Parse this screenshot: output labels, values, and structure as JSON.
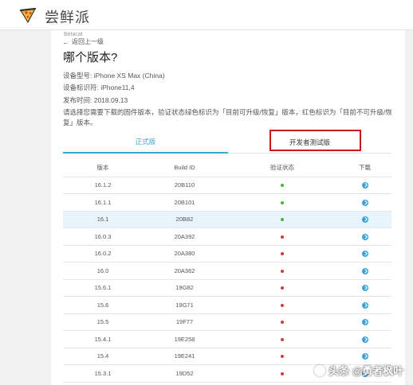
{
  "header": {
    "brand": "尝鲜派",
    "colors": {
      "accent": "#3ca3d8",
      "highlight": "#c81a1a"
    }
  },
  "page": {
    "crumb_top": "Betacat",
    "back": "返回上一级",
    "title": "哪个版本?",
    "device_model": "设备型号: iPhone XS Max (China)",
    "device_id": "设备标识符: iPhone11,4",
    "release_date": "发布时间: 2018.09.13",
    "description": "请选择您需要下载的固件版本，验证状态绿色标识为「目前可升级/恢复」版本，红色标识为「目前不可升级/恢复」版本。"
  },
  "tabs": [
    {
      "label": "正式版",
      "active": true
    },
    {
      "label": "开发者测试版",
      "active": false
    }
  ],
  "table": {
    "headers": [
      "版本",
      "Build ID",
      "验证状态",
      "下载"
    ],
    "rows": [
      {
        "version": "16.1.2",
        "build": "20B110",
        "signed": true
      },
      {
        "version": "16.1.1",
        "build": "20B101",
        "signed": true
      },
      {
        "version": "16.1",
        "build": "20B82",
        "signed": true,
        "selected": true
      },
      {
        "version": "16.0.3",
        "build": "20A392",
        "signed": false
      },
      {
        "version": "16.0.2",
        "build": "20A380",
        "signed": false
      },
      {
        "version": "16.0",
        "build": "20A362",
        "signed": false
      },
      {
        "version": "15.6.1",
        "build": "19G82",
        "signed": false
      },
      {
        "version": "15.6",
        "build": "19G71",
        "signed": false
      },
      {
        "version": "15.5",
        "build": "19F77",
        "signed": false
      },
      {
        "version": "15.4.1",
        "build": "19E258",
        "signed": false
      },
      {
        "version": "15.4",
        "build": "19E241",
        "signed": false
      },
      {
        "version": "15.3.1",
        "build": "19D52",
        "signed": false
      }
    ]
  },
  "watermark": {
    "text": "头条 @勇者枫叶"
  }
}
